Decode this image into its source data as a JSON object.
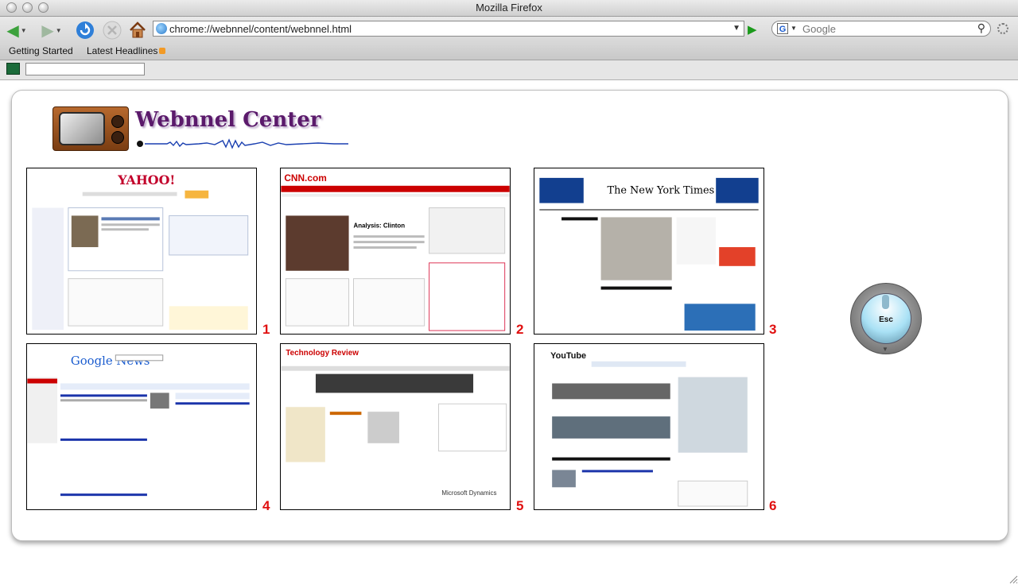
{
  "window": {
    "title": "Mozilla Firefox"
  },
  "toolbar": {
    "url": "chrome://webnnel/content/webnnel.html",
    "search_engine_icon": "G",
    "search_placeholder": "Google"
  },
  "bookmarks": [
    {
      "label": "Getting Started"
    },
    {
      "label": "Latest Headlines"
    }
  ],
  "page": {
    "logo_text": "Webnnel Center",
    "esc_label": "Esc",
    "thumbnails": [
      {
        "number": "1",
        "site": "yahoo",
        "logo": "YAHOO!"
      },
      {
        "number": "2",
        "site": "cnn",
        "logo": "CNN.com"
      },
      {
        "number": "3",
        "site": "nytimes",
        "logo": "The New York Times"
      },
      {
        "number": "4",
        "site": "google-news",
        "logo": "Google News"
      },
      {
        "number": "5",
        "site": "technology-review",
        "logo": "Technology Review"
      },
      {
        "number": "6",
        "site": "youtube",
        "logo": "YouTube"
      }
    ]
  },
  "colors": {
    "accent_number": "#e01010",
    "logo_purple": "#5b1a6b",
    "esc_glass": "#a9e1f5"
  }
}
